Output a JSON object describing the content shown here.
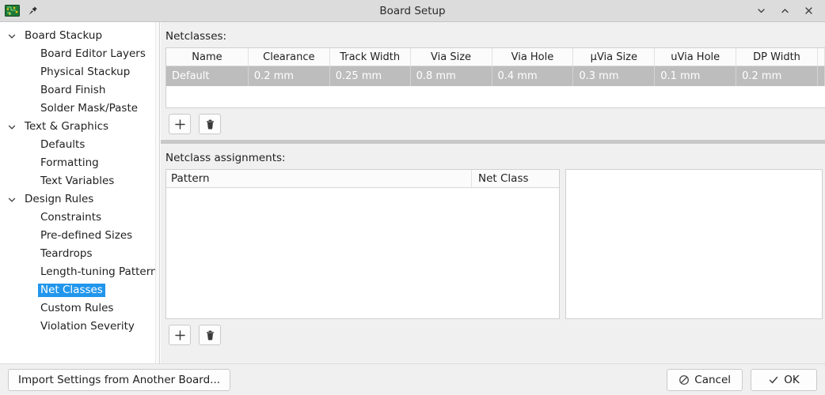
{
  "titlebar": {
    "title": "Board Setup",
    "app_icon": "kicad-pcb-icon",
    "pin_icon": "pin-icon",
    "minimize_icon": "chevron-down-icon",
    "maximize_icon": "chevron-up-icon",
    "close_icon": "close-icon"
  },
  "sidebar": {
    "items": [
      {
        "label": "Board Stackup",
        "level": 0,
        "expanded": true,
        "selected": false
      },
      {
        "label": "Board Editor Layers",
        "level": 1,
        "expanded": null,
        "selected": false
      },
      {
        "label": "Physical Stackup",
        "level": 1,
        "expanded": null,
        "selected": false
      },
      {
        "label": "Board Finish",
        "level": 1,
        "expanded": null,
        "selected": false
      },
      {
        "label": "Solder Mask/Paste",
        "level": 1,
        "expanded": null,
        "selected": false
      },
      {
        "label": "Text & Graphics",
        "level": 0,
        "expanded": true,
        "selected": false
      },
      {
        "label": "Defaults",
        "level": 1,
        "expanded": null,
        "selected": false
      },
      {
        "label": "Formatting",
        "level": 1,
        "expanded": null,
        "selected": false
      },
      {
        "label": "Text Variables",
        "level": 1,
        "expanded": null,
        "selected": false
      },
      {
        "label": "Design Rules",
        "level": 0,
        "expanded": true,
        "selected": false
      },
      {
        "label": "Constraints",
        "level": 1,
        "expanded": null,
        "selected": false
      },
      {
        "label": "Pre-defined Sizes",
        "level": 1,
        "expanded": null,
        "selected": false
      },
      {
        "label": "Teardrops",
        "level": 1,
        "expanded": null,
        "selected": false
      },
      {
        "label": "Length-tuning Patterns",
        "level": 1,
        "expanded": null,
        "selected": false
      },
      {
        "label": "Net Classes",
        "level": 1,
        "expanded": null,
        "selected": true
      },
      {
        "label": "Custom Rules",
        "level": 1,
        "expanded": null,
        "selected": false
      },
      {
        "label": "Violation Severity",
        "level": 1,
        "expanded": null,
        "selected": false
      }
    ],
    "selection_color": "#2196ec"
  },
  "netclasses": {
    "label": "Netclasses:",
    "columns": [
      "Name",
      "Clearance",
      "Track Width",
      "Via Size",
      "Via Hole",
      "μVia Size",
      "uVia Hole",
      "DP Width"
    ],
    "rows": [
      {
        "selected": true,
        "cells": [
          "Default",
          "0.2 mm",
          "0.25 mm",
          "0.8 mm",
          "0.4 mm",
          "0.3 mm",
          "0.1 mm",
          "0.2 mm"
        ]
      }
    ],
    "selected_row_bg": "#bdbdbd",
    "toolbar": {
      "add_icon": "plus-icon",
      "delete_icon": "trash-icon"
    }
  },
  "assignments": {
    "label": "Netclass assignments:",
    "columns": [
      "Pattern",
      "Net Class"
    ],
    "rows": [],
    "toolbar": {
      "add_icon": "plus-icon",
      "delete_icon": "trash-icon"
    }
  },
  "bottombar": {
    "import_label": "Import Settings from Another Board...",
    "cancel_label": "Cancel",
    "cancel_icon": "no-entry-icon",
    "ok_label": "OK",
    "ok_icon": "check-icon"
  }
}
